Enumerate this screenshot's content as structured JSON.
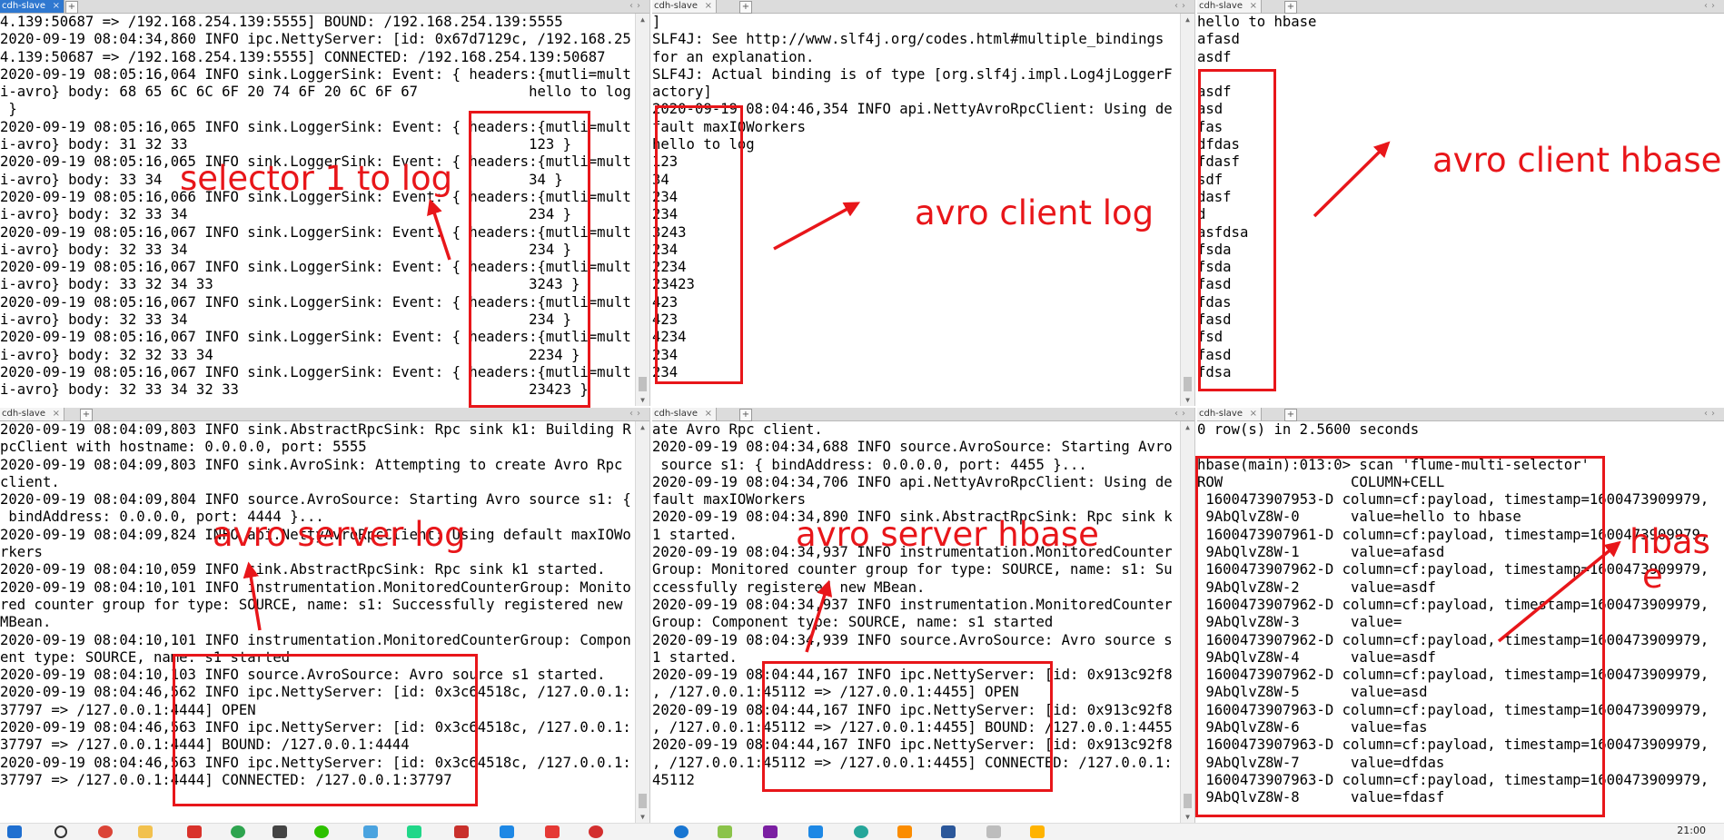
{
  "colors": {
    "annotation": "#e8161a",
    "active_tab": "#2f78d0"
  },
  "panes": [
    {
      "tab": "cdh-slave",
      "active": true,
      "lines": [
        "4.139:50687 => /192.168.254.139:5555] BOUND: /192.168.254.139:5555",
        "2020-09-19 08:04:34,860 INFO ipc.NettyServer: [id: 0x67d7129c, /192.168.25",
        "4.139:50687 => /192.168.254.139:5555] CONNECTED: /192.168.254.139:50687",
        "2020-09-19 08:05:16,064 INFO sink.LoggerSink: Event: { headers:{mutli=mult",
        "i-avro} body: 68 65 6C 6C 6F 20 74 6F 20 6C 6F 67             hello to log",
        " }",
        "2020-09-19 08:05:16,065 INFO sink.LoggerSink: Event: { headers:{mutli=mult",
        "i-avro} body: 31 32 33                                        123 }",
        "2020-09-19 08:05:16,065 INFO sink.LoggerSink: Event: { headers:{mutli=mult",
        "i-avro} body: 33 34                                           34 }",
        "2020-09-19 08:05:16,066 INFO sink.LoggerSink: Event: { headers:{mutli=mult",
        "i-avro} body: 32 33 34                                        234 }",
        "2020-09-19 08:05:16,067 INFO sink.LoggerSink: Event: { headers:{mutli=mult",
        "i-avro} body: 32 33 34                                        234 }",
        "2020-09-19 08:05:16,067 INFO sink.LoggerSink: Event: { headers:{mutli=mult",
        "i-avro} body: 33 32 34 33                                     3243 }",
        "2020-09-19 08:05:16,067 INFO sink.LoggerSink: Event: { headers:{mutli=mult",
        "i-avro} body: 32 33 34                                        234 }",
        "2020-09-19 08:05:16,067 INFO sink.LoggerSink: Event: { headers:{mutli=mult",
        "i-avro} body: 32 32 33 34                                     2234 }",
        "2020-09-19 08:05:16,067 INFO sink.LoggerSink: Event: { headers:{mutli=mult",
        "i-avro} body: 32 33 34 32 33                                  23423 }"
      ]
    },
    {
      "tab": "cdh-slave",
      "active": false,
      "lines": [
        "]",
        "SLF4J: See http://www.slf4j.org/codes.html#multiple_bindings",
        "for an explanation.",
        "SLF4J: Actual binding is of type [org.slf4j.impl.Log4jLoggerF",
        "actory]",
        "2020-09-19 08:04:46,354 INFO api.NettyAvroRpcClient: Using de",
        "fault maxIOWorkers",
        "hello to log",
        "123",
        "34",
        "234",
        "234",
        "3243",
        "234",
        "2234",
        "23423",
        "423",
        "423",
        "4234",
        "234",
        "234"
      ]
    },
    {
      "tab": "cdh-slave",
      "active": false,
      "lines": [
        "hello to hbase",
        "afasd",
        "asdf",
        "",
        "asdf",
        "asd",
        "fas",
        "dfdas",
        "fdasf",
        "sdf",
        "dasf",
        "d",
        "asfdsa",
        "fsda",
        "fsda",
        "fasd",
        "fdas",
        "fasd",
        "fsd",
        "fasd",
        "fdsa"
      ]
    },
    {
      "tab": "cdh-slave",
      "active": false,
      "lines": [
        "2020-09-19 08:04:09,803 INFO sink.AbstractRpcSink: Rpc sink k1: Building R",
        "pcClient with hostname: 0.0.0.0, port: 5555",
        "2020-09-19 08:04:09,803 INFO sink.AvroSink: Attempting to create Avro Rpc",
        "client.",
        "2020-09-19 08:04:09,804 INFO source.AvroSource: Starting Avro source s1: {",
        " bindAddress: 0.0.0.0, port: 4444 }...",
        "2020-09-19 08:04:09,824 INFO api.NettyAvroRpcClient: Using default maxIOWo",
        "rkers",
        "2020-09-19 08:04:10,059 INFO sink.AbstractRpcSink: Rpc sink k1 started.",
        "2020-09-19 08:04:10,101 INFO instrumentation.MonitoredCounterGroup: Monito",
        "red counter group for type: SOURCE, name: s1: Successfully registered new",
        "MBean.",
        "2020-09-19 08:04:10,101 INFO instrumentation.MonitoredCounterGroup: Compon",
        "ent type: SOURCE, name: s1 started",
        "2020-09-19 08:04:10,103 INFO source.AvroSource: Avro source s1 started.",
        "2020-09-19 08:04:46,562 INFO ipc.NettyServer: [id: 0x3c64518c, /127.0.0.1:",
        "37797 => /127.0.0.1:4444] OPEN",
        "2020-09-19 08:04:46,563 INFO ipc.NettyServer: [id: 0x3c64518c, /127.0.0.1:",
        "37797 => /127.0.0.1:4444] BOUND: /127.0.0.1:4444",
        "2020-09-19 08:04:46,563 INFO ipc.NettyServer: [id: 0x3c64518c, /127.0.0.1:",
        "37797 => /127.0.0.1:4444] CONNECTED: /127.0.0.1:37797"
      ]
    },
    {
      "tab": "cdh-slave",
      "active": false,
      "lines": [
        "ate Avro Rpc client.",
        "2020-09-19 08:04:34,688 INFO source.AvroSource: Starting Avro",
        " source s1: { bindAddress: 0.0.0.0, port: 4455 }...",
        "2020-09-19 08:04:34,706 INFO api.NettyAvroRpcClient: Using de",
        "fault maxIOWorkers",
        "2020-09-19 08:04:34,890 INFO sink.AbstractRpcSink: Rpc sink k",
        "1 started.",
        "2020-09-19 08:04:34,937 INFO instrumentation.MonitoredCounter",
        "Group: Monitored counter group for type: SOURCE, name: s1: Su",
        "ccessfully registered new MBean.",
        "2020-09-19 08:04:34,937 INFO instrumentation.MonitoredCounter",
        "Group: Component type: SOURCE, name: s1 started",
        "2020-09-19 08:04:34,939 INFO source.AvroSource: Avro source s",
        "1 started.",
        "2020-09-19 08:04:44,167 INFO ipc.NettyServer: [id: 0x913c92f8",
        ", /127.0.0.1:45112 => /127.0.0.1:4455] OPEN",
        "2020-09-19 08:04:44,167 INFO ipc.NettyServer: [id: 0x913c92f8",
        ", /127.0.0.1:45112 => /127.0.0.1:4455] BOUND: /127.0.0.1:4455",
        "2020-09-19 08:04:44,167 INFO ipc.NettyServer: [id: 0x913c92f8",
        ", /127.0.0.1:45112 => /127.0.0.1:4455] CONNECTED: /127.0.0.1:",
        "45112"
      ]
    },
    {
      "tab": "cdh-slave",
      "active": false,
      "lines": [
        "0 row(s) in 2.5600 seconds",
        "",
        "hbase(main):013:0> scan 'flume-multi-selector'",
        "ROW               COLUMN+CELL",
        " 1600473907953-D column=cf:payload, timestamp=1600473909979,",
        " 9AbQlvZ8W-0      value=hello to hbase",
        " 1600473907961-D column=cf:payload, timestamp=1600473909979,",
        " 9AbQlvZ8W-1      value=afasd",
        " 1600473907962-D column=cf:payload, timestamp=1600473909979,",
        " 9AbQlvZ8W-2      value=asdf",
        " 1600473907962-D column=cf:payload, timestamp=1600473909979,",
        " 9AbQlvZ8W-3      value=",
        " 1600473907962-D column=cf:payload, timestamp=1600473909979,",
        " 9AbQlvZ8W-4      value=asdf",
        " 1600473907962-D column=cf:payload, timestamp=1600473909979,",
        " 9AbQlvZ8W-5      value=asd",
        " 1600473907963-D column=cf:payload, timestamp=1600473909979,",
        " 9AbQlvZ8W-6      value=fas",
        " 1600473907963-D column=cf:payload, timestamp=1600473909979,",
        " 9AbQlvZ8W-7      value=dfdas",
        " 1600473907963-D column=cf:payload, timestamp=1600473909979,",
        " 9AbQlvZ8W-8      value=fdasf"
      ]
    }
  ],
  "annotations": {
    "selector_log": "selector 1 to log",
    "avro_client_log": "avro client log",
    "avro_client_hbase": "avro client hbase",
    "avro_server_log": "avro server log",
    "avro_server_hbase": "avro server hbase",
    "hbase_part1": "hbas",
    "hbase_part2": "e"
  },
  "taskbar": {
    "clock": "21:00"
  }
}
